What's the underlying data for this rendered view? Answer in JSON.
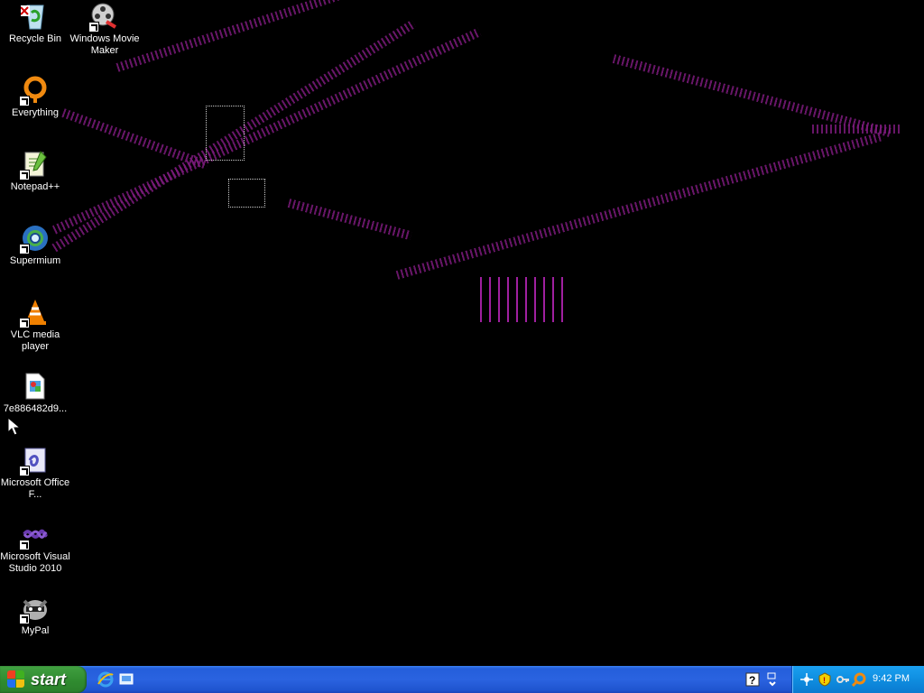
{
  "desktop": {
    "icons": [
      {
        "label": "Recycle Bin",
        "icon": "recycle-bin-icon"
      },
      {
        "label": "Windows Movie Maker",
        "icon": "movie-maker-icon"
      },
      {
        "label": "Everything",
        "icon": "everything-search-icon"
      },
      {
        "label": "Notepad++",
        "icon": "notepadpp-icon"
      },
      {
        "label": "Supermium",
        "icon": "supermium-browser-icon"
      },
      {
        "label": "VLC media player",
        "icon": "vlc-cone-icon"
      },
      {
        "label": "7e886482d9...",
        "icon": "image-file-icon"
      },
      {
        "label": "Microsoft Office F...",
        "icon": "office-file-icon"
      },
      {
        "label": "Microsoft Visual Studio 2010",
        "icon": "visual-studio-icon"
      },
      {
        "label": "MyPal",
        "icon": "mypal-raccoon-icon"
      }
    ]
  },
  "taskbar": {
    "start_label": "start",
    "quick_launch": [
      "ie-icon",
      "show-desktop-icon"
    ],
    "clock": "9:42 PM",
    "tray_icons": [
      "help-icon",
      "language-bar-icon",
      "network-icon",
      "security-shield-icon",
      "key-icon",
      "everything-search-icon"
    ]
  },
  "colors": {
    "taskbar_blue": "#245edb",
    "start_green": "#3c9a3c",
    "tray_blue": "#0f8ee0",
    "artifact_magenta": "#a020a0"
  }
}
